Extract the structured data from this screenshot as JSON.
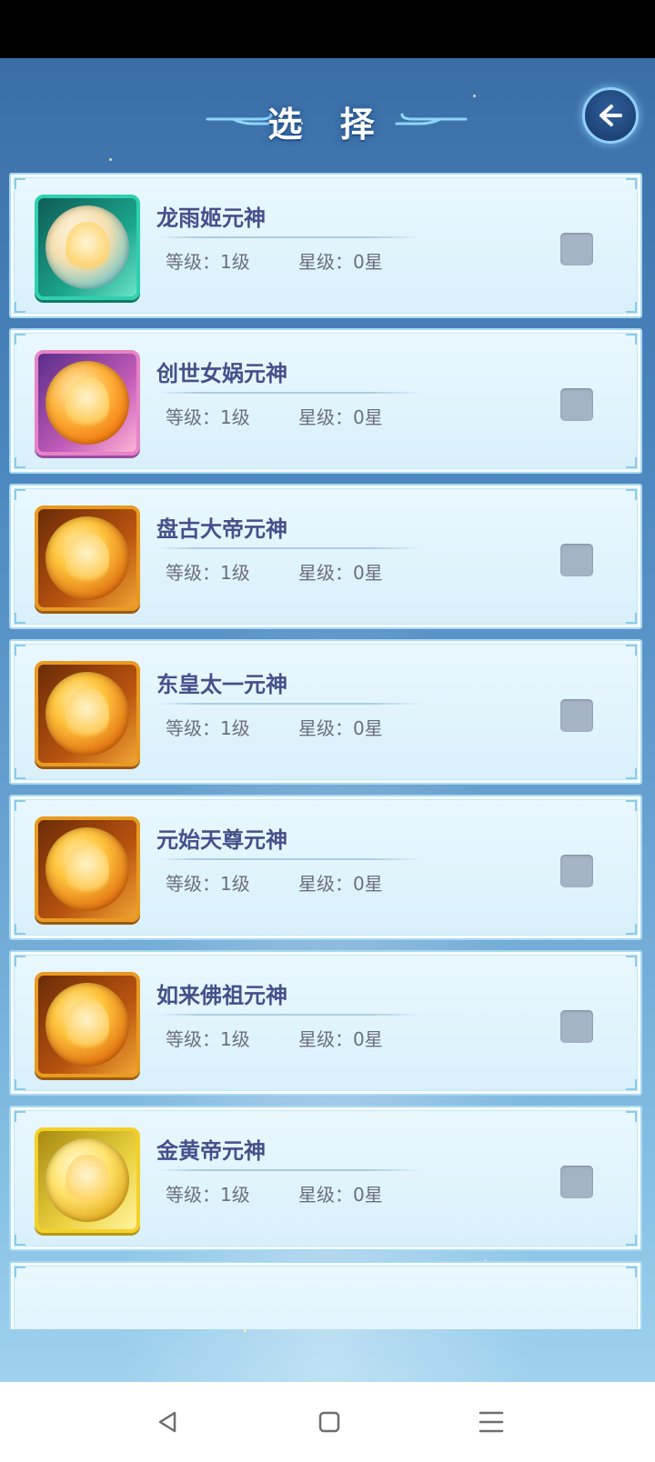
{
  "header": {
    "title": "选 择"
  },
  "stat_labels": {
    "level": "等级：",
    "star": "星级："
  },
  "items": [
    {
      "name": "龙雨姬元神",
      "level": "1级",
      "star": "0星",
      "portrait": "teal"
    },
    {
      "name": "创世女娲元神",
      "level": "1级",
      "star": "0星",
      "portrait": "pink"
    },
    {
      "name": "盘古大帝元神",
      "level": "1级",
      "star": "0星",
      "portrait": "orange"
    },
    {
      "name": "东皇太一元神",
      "level": "1级",
      "star": "0星",
      "portrait": "orange"
    },
    {
      "name": "元始天尊元神",
      "level": "1级",
      "star": "0星",
      "portrait": "orange"
    },
    {
      "name": "如来佛祖元神",
      "level": "1级",
      "star": "0星",
      "portrait": "orange"
    },
    {
      "name": "金黄帝元神",
      "level": "1级",
      "star": "0星",
      "portrait": "gold"
    }
  ],
  "icons": {
    "back_button": "back-arrow-icon",
    "nav_back": "triangle-back-icon",
    "nav_home": "square-home-icon",
    "nav_menu": "menu-lines-icon"
  },
  "colors": {
    "name_text": "#45508a",
    "stat_text": "#6b6f80",
    "checkbox": "#a5b3c6",
    "card_bg": "#e2f4fc"
  }
}
